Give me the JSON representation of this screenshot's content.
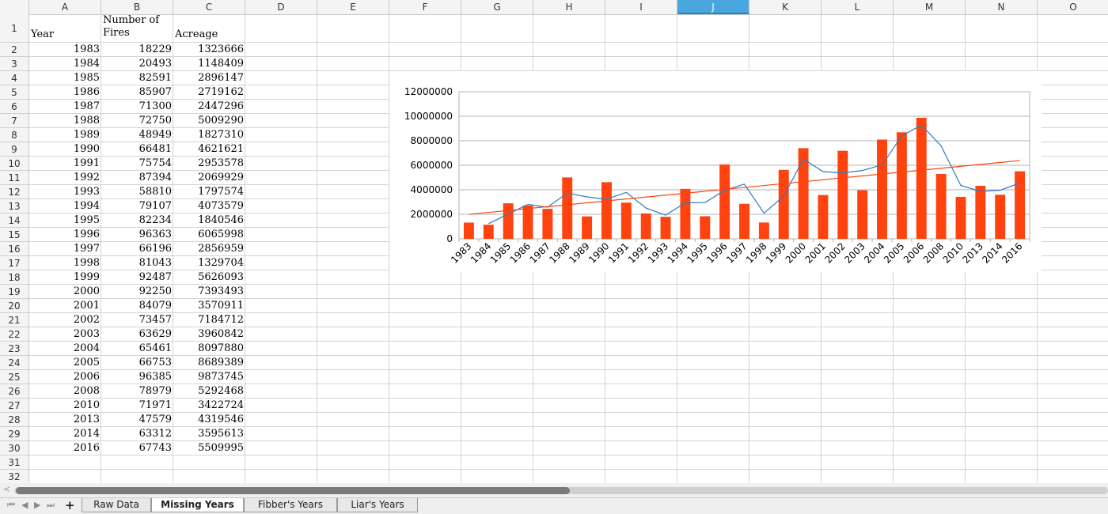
{
  "columns": [
    "A",
    "B",
    "C",
    "D",
    "E",
    "F",
    "G",
    "H",
    "I",
    "J",
    "K",
    "L",
    "M",
    "N",
    "O"
  ],
  "active_column": "J",
  "rows": [
    "1",
    "2",
    "3",
    "4",
    "5",
    "6",
    "7",
    "8",
    "9",
    "10",
    "11",
    "12",
    "13",
    "14",
    "15",
    "16",
    "17",
    "18",
    "19",
    "20",
    "21",
    "22",
    "23",
    "24",
    "25",
    "26",
    "27",
    "28",
    "29",
    "30",
    "31",
    "32"
  ],
  "headers": {
    "year": "Year",
    "fires_line1": "Number of",
    "fires_line2": "Fires",
    "acreage": "Acreage"
  },
  "table": [
    [
      "1983",
      "18229",
      "1323666"
    ],
    [
      "1984",
      "20493",
      "1148409"
    ],
    [
      "1985",
      "82591",
      "2896147"
    ],
    [
      "1986",
      "85907",
      "2719162"
    ],
    [
      "1987",
      "71300",
      "2447296"
    ],
    [
      "1988",
      "72750",
      "5009290"
    ],
    [
      "1989",
      "48949",
      "1827310"
    ],
    [
      "1990",
      "66481",
      "4621621"
    ],
    [
      "1991",
      "75754",
      "2953578"
    ],
    [
      "1992",
      "87394",
      "2069929"
    ],
    [
      "1993",
      "58810",
      "1797574"
    ],
    [
      "1994",
      "79107",
      "4073579"
    ],
    [
      "1995",
      "82234",
      "1840546"
    ],
    [
      "1996",
      "96363",
      "6065998"
    ],
    [
      "1997",
      "66196",
      "2856959"
    ],
    [
      "1998",
      "81043",
      "1329704"
    ],
    [
      "1999",
      "92487",
      "5626093"
    ],
    [
      "2000",
      "92250",
      "7393493"
    ],
    [
      "2001",
      "84079",
      "3570911"
    ],
    [
      "2002",
      "73457",
      "7184712"
    ],
    [
      "2003",
      "63629",
      "3960842"
    ],
    [
      "2004",
      "65461",
      "8097880"
    ],
    [
      "2005",
      "66753",
      "8689389"
    ],
    [
      "2006",
      "96385",
      "9873745"
    ],
    [
      "2008",
      "78979",
      "5292468"
    ],
    [
      "2010",
      "71971",
      "3422724"
    ],
    [
      "2013",
      "47579",
      "4319546"
    ],
    [
      "2014",
      "63312",
      "3595613"
    ],
    [
      "2016",
      "67743",
      "5509995"
    ]
  ],
  "chart_data": {
    "type": "bar",
    "categories": [
      "1983",
      "1984",
      "1985",
      "1986",
      "1987",
      "1988",
      "1989",
      "1990",
      "1991",
      "1992",
      "1993",
      "1994",
      "1995",
      "1996",
      "1997",
      "1998",
      "1999",
      "2000",
      "2001",
      "2002",
      "2003",
      "2004",
      "2005",
      "2006",
      "2008",
      "2010",
      "2013",
      "2014",
      "2016"
    ],
    "series": [
      {
        "values": [
          1323666,
          1148409,
          2896147,
          2719162,
          2447296,
          5009290,
          1827310,
          4621621,
          2953578,
          2069929,
          1797574,
          4073579,
          1840546,
          6065998,
          2856959,
          1329704,
          5626093,
          7393493,
          3570911,
          7184712,
          3960842,
          8097880,
          8689389,
          9873745,
          5292468,
          3422724,
          4319546,
          3595613,
          5509995
        ]
      }
    ],
    "overlays": [
      "moving-average",
      "linear-trend"
    ],
    "ylim": [
      0,
      12000000
    ],
    "yticks": [
      "0",
      "2000000",
      "4000000",
      "6000000",
      "8000000",
      "10000000",
      "12000000"
    ],
    "grid": true,
    "colors": {
      "bars": "#ff420e",
      "moving_average": "#2e7bc4",
      "trend": "#ff420e"
    }
  },
  "sheet_tabs": [
    {
      "label": "Raw Data",
      "active": false
    },
    {
      "label": "Missing Years",
      "active": true
    },
    {
      "label": "Fibber's Years",
      "active": false
    },
    {
      "label": "Liar's Years",
      "active": false
    }
  ],
  "nav": {
    "first": "⏮",
    "prev": "◀",
    "next": "▶",
    "last": "⏭",
    "add": "+",
    "scroll_left": "<"
  }
}
